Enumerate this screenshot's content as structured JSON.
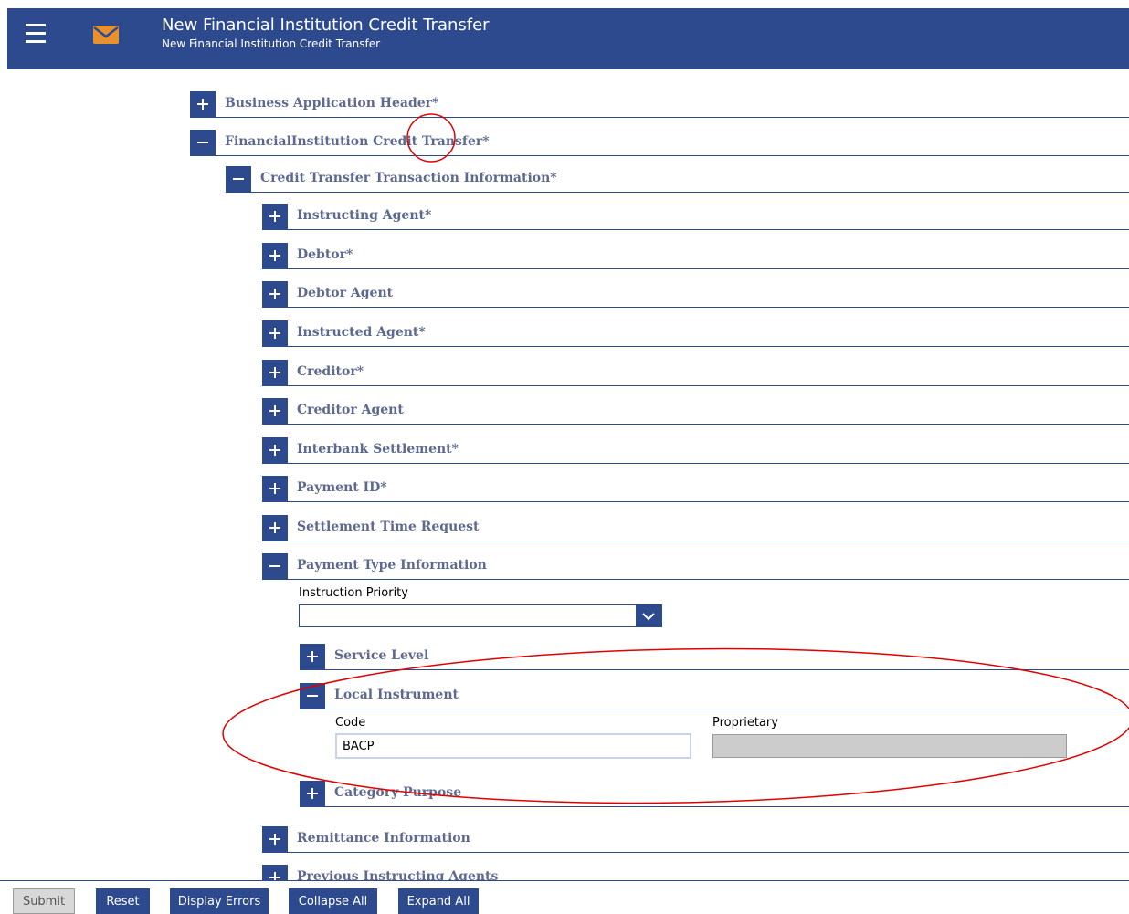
{
  "header": {
    "title": "New Financial Institution Credit Transfer",
    "subtitle": "New Financial Institution Credit Transfer"
  },
  "tree": {
    "business_application_header": "Business Application Header*",
    "financial_institution_credit_transfer": "FinancialInstitution Credit Transfer*",
    "credit_transfer_transaction_information": "Credit Transfer Transaction Information*",
    "instructing_agent": "Instructing Agent*",
    "debtor": "Debtor*",
    "debtor_agent": "Debtor Agent",
    "instructed_agent": "Instructed Agent*",
    "creditor": "Creditor*",
    "creditor_agent": "Creditor Agent",
    "interbank_settlement": "Interbank Settlement*",
    "payment_id": "Payment ID*",
    "settlement_time_request": "Settlement Time Request",
    "payment_type_information": "Payment Type Information",
    "service_level": "Service Level",
    "local_instrument": "Local Instrument",
    "category_purpose": "Category Purpose",
    "remittance_information": "Remittance Information",
    "previous_instructing_agents": "Previous Instructing Agents"
  },
  "form": {
    "instruction_priority_label": "Instruction Priority",
    "instruction_priority_value": "",
    "code_label": "Code",
    "code_value": "BACP",
    "proprietary_label": "Proprietary",
    "proprietary_value": ""
  },
  "footer": {
    "submit": "Submit",
    "reset": "Reset",
    "display_errors": "Display Errors",
    "collapse_all": "Collapse All",
    "expand_all": "Expand All"
  },
  "colors": {
    "header_bg": "#2e4a8e",
    "accent": "#2e4a8e",
    "label_text": "#5e6990",
    "mail_icon": "#e8912d",
    "annotation": "#e00000"
  }
}
